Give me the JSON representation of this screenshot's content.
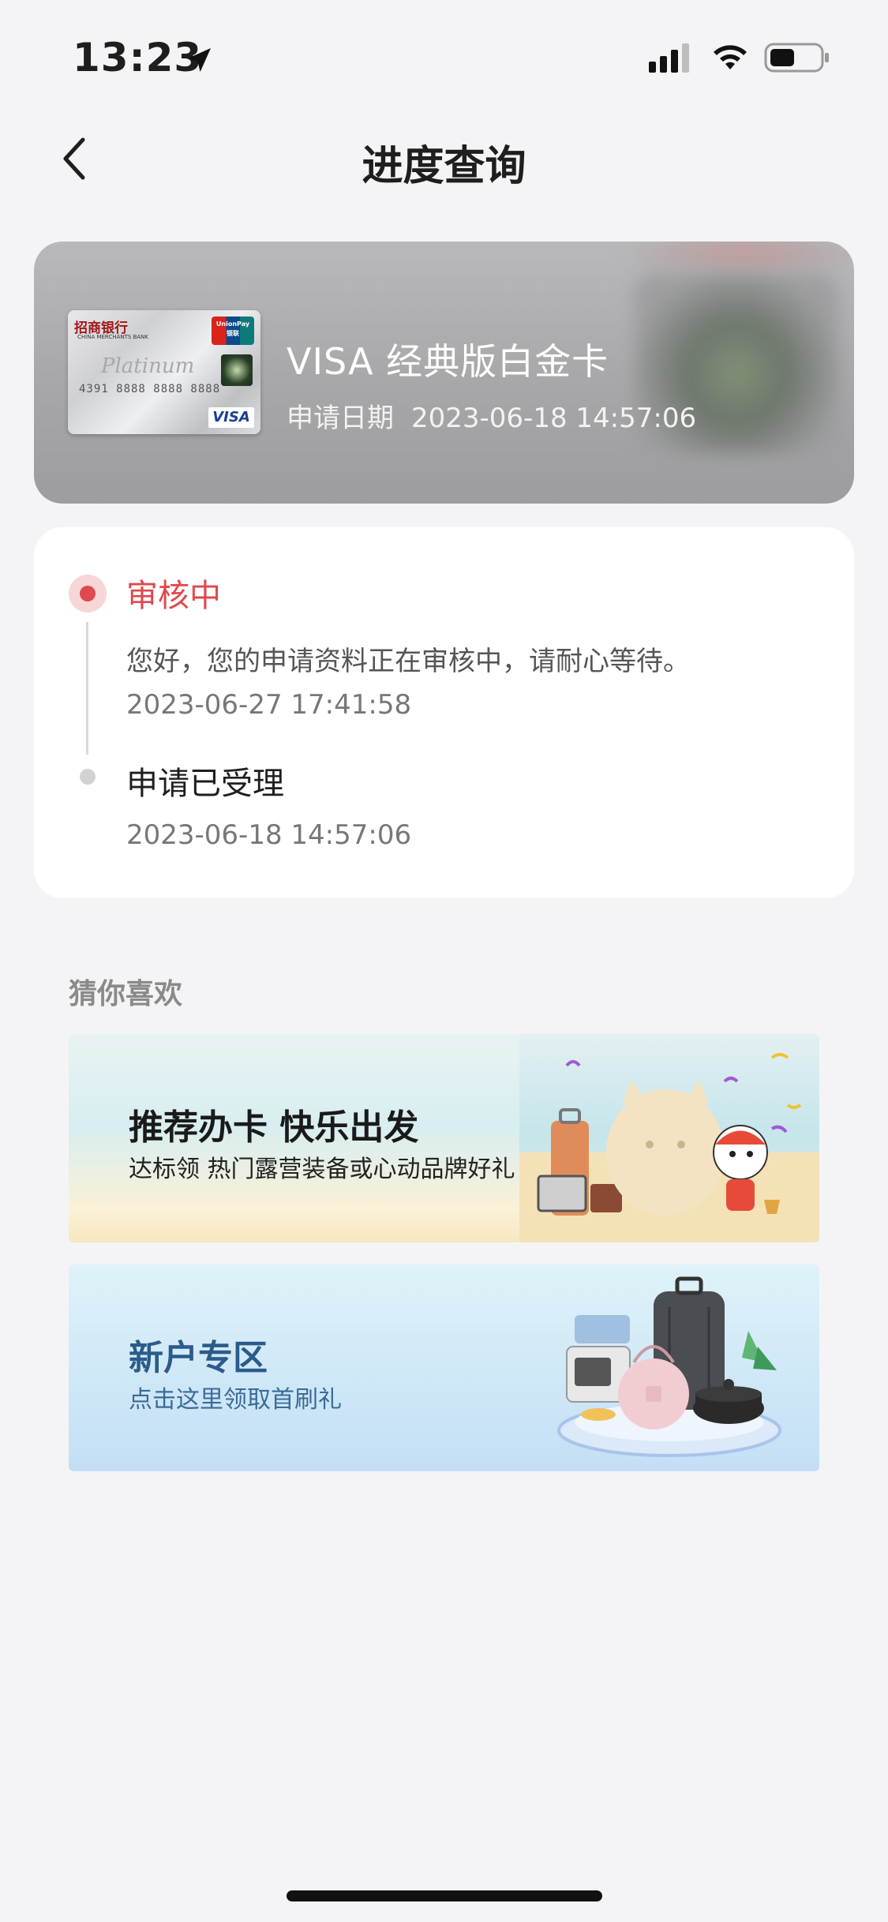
{
  "status_bar": {
    "time": "13:23",
    "icons": [
      "location-arrow-icon",
      "signal-icon",
      "wifi-icon",
      "battery-icon"
    ]
  },
  "nav": {
    "back_icon": "chevron-left-icon",
    "title": "进度查询"
  },
  "card": {
    "name": "VISA 经典版白金卡",
    "apply_date_label": "申请日期",
    "apply_date_value": "2023-06-18 14:57:06",
    "thumbnail": {
      "bank": "招商银行",
      "network_badge": "UnionPay 银联",
      "brand": "VISA",
      "tier": "Platinum",
      "number": "4391 8888 8888 8888"
    }
  },
  "progress": {
    "steps": [
      {
        "status": "审核中",
        "description": "您好，您的申请资料正在审核中，请耐心等待。",
        "time": "2023-06-27 17:41:58",
        "active": true
      },
      {
        "status": "申请已受理",
        "time": "2023-06-18 14:57:06",
        "active": false
      }
    ]
  },
  "recommend": {
    "heading": "猜你喜欢",
    "banners": [
      {
        "title": "推荐办卡  快乐出发",
        "subtitle": "达标领 热门露营装备或心动品牌好礼"
      },
      {
        "title": "新户专区",
        "subtitle": "点击这里领取首刷礼"
      }
    ]
  },
  "colors": {
    "accent_red": "#e0484f",
    "page_bg": "#f4f4f6",
    "banner2_text": "#2a5b8a"
  }
}
